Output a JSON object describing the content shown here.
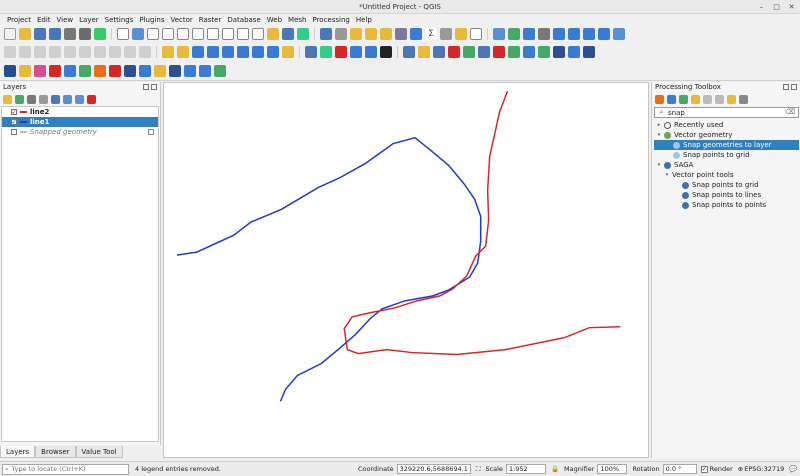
{
  "window": {
    "title": "*Untitled Project - QGIS",
    "controls": [
      "–",
      "□",
      "✕"
    ]
  },
  "menu": [
    "Project",
    "Edit",
    "View",
    "Layer",
    "Settings",
    "Plugins",
    "Vector",
    "Raster",
    "Database",
    "Web",
    "Mesh",
    "Processing",
    "Help"
  ],
  "layers_panel": {
    "title": "Layers",
    "layers": [
      {
        "name": "line2",
        "checked": true,
        "color": "#d62728"
      },
      {
        "name": "line1",
        "checked": true,
        "color": "#1f3bd1"
      },
      {
        "name": "Snapped geometry",
        "checked": false,
        "color": "#bbbbbb"
      }
    ]
  },
  "bottom_tabs": [
    "Layers",
    "Browser",
    "Value Tool"
  ],
  "toolbox": {
    "title": "Processing Toolbox",
    "search_value": "snap",
    "tree": [
      {
        "label": "Recently used",
        "level": 0,
        "arrow": "▸"
      },
      {
        "label": "Vector geometry",
        "level": 0,
        "arrow": "▾"
      },
      {
        "label": "Snap geometries to layer",
        "level": 1,
        "arrow": ""
      },
      {
        "label": "Snap points to grid",
        "level": 1,
        "arrow": ""
      },
      {
        "label": "SAGA",
        "level": 0,
        "arrow": "▾"
      },
      {
        "label": "Vector point tools",
        "level": 1,
        "arrow": "▾"
      },
      {
        "label": "Snap points to grid",
        "level": 2,
        "arrow": ""
      },
      {
        "label": "Snap points to lines",
        "level": 2,
        "arrow": ""
      },
      {
        "label": "Snap points to points",
        "level": 2,
        "arrow": ""
      }
    ]
  },
  "statusbar": {
    "locate_placeholder": "Type to locate (Ctrl+K)",
    "message": "4 legend entries removed.",
    "coordinate_label": "Coordinate",
    "coordinate_value": "329220.6,5688694.1",
    "scale_label": "Scale",
    "scale_value": "1:952",
    "magnifier_label": "Magnifier",
    "magnifier_value": "100%",
    "rotation_label": "Rotation",
    "rotation_value": "0.0 °",
    "render_label": "Render",
    "crs": "EPSG:32719"
  },
  "colors": {
    "selection": "#2f7fc1",
    "line1": "#1f3bd1",
    "line2": "#d62728"
  }
}
